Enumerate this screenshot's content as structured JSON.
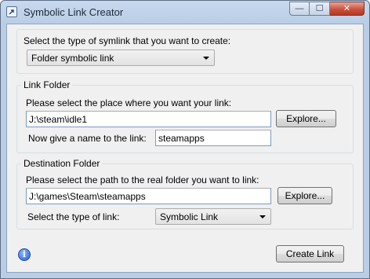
{
  "window": {
    "title": "Symbolic Link Creator",
    "icons": {
      "app": "symlink-app-icon",
      "minimize": "minimize-icon",
      "maximize": "maximize-icon",
      "close": "close-icon",
      "info": "info-icon"
    },
    "caption_glyphs": {
      "minimize": "—",
      "maximize": "☐",
      "close": "✕"
    }
  },
  "type_section": {
    "prompt": "Select the type of symlink that you want to create:",
    "selected": "Folder symbolic link"
  },
  "link_folder": {
    "legend": "Link Folder",
    "prompt": "Please select the place where you want your link:",
    "path_value": "J:\\steam\\idle1",
    "explore_label": "Explore...",
    "name_prompt": "Now give a name to the link:",
    "name_value": "steamapps"
  },
  "destination_folder": {
    "legend": "Destination Folder",
    "prompt": "Please select the path to the real folder you want to link:",
    "path_value": "J:\\games\\Steam\\steamapps",
    "explore_label": "Explore...",
    "link_type_prompt": "Select the type of link:",
    "link_type_selected": "Symbolic Link"
  },
  "footer": {
    "info_glyph": "i",
    "create_label": "Create Link"
  }
}
